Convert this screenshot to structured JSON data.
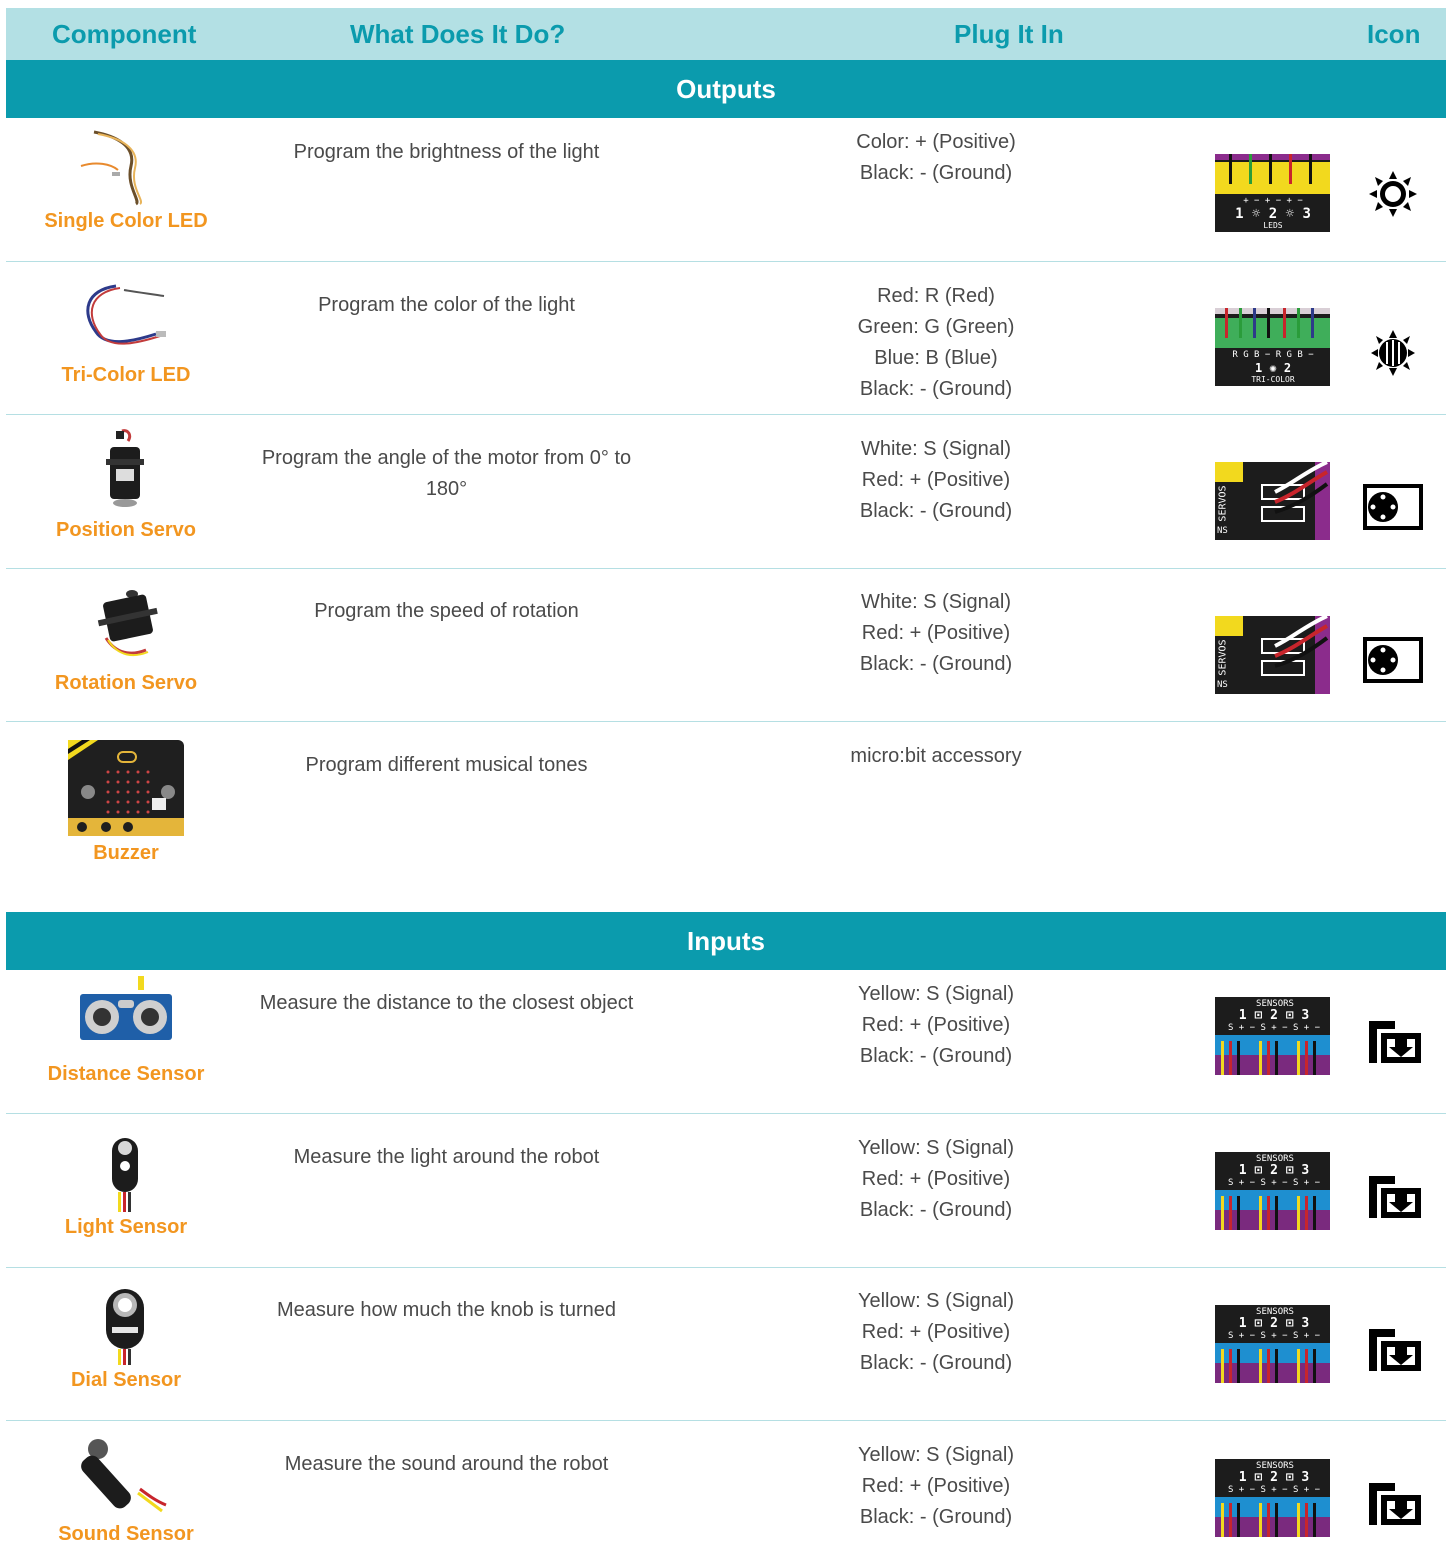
{
  "header": {
    "component": "Component",
    "what": "What Does It Do?",
    "plug": "Plug It In",
    "icon": "Icon"
  },
  "colors": {
    "header_bg": "#b3e0e4",
    "header_text": "#0b9bad",
    "section_bg": "#0b9bad",
    "component_name": "#f29620",
    "body_text": "#4a4a4a",
    "separator": "#b5dfe3"
  },
  "sections": [
    {
      "title": "Outputs",
      "rows": [
        {
          "name": "Single Color LED",
          "image": "single-color-led-image",
          "description": "Program the brightness of the light",
          "plug": [
            "Color: + (Positive)",
            "Black: - (Ground)"
          ],
          "board": "leds-port-image",
          "icon": "led-sun-icon"
        },
        {
          "name": "Tri-Color LED",
          "image": "tri-color-led-image",
          "description": "Program the color of the light",
          "plug": [
            "Red: R (Red)",
            "Green: G (Green)",
            "Blue: B (Blue)",
            "Black: - (Ground)"
          ],
          "board": "tri-color-port-image",
          "icon": "tri-color-led-icon"
        },
        {
          "name": "Position Servo",
          "image": "position-servo-image",
          "description": "Program the angle of the motor from 0° to 180°",
          "plug": [
            "White: S (Signal)",
            "Red: + (Positive)",
            "Black: - (Ground)"
          ],
          "board": "servos-port-image",
          "icon": "servo-icon"
        },
        {
          "name": "Rotation Servo",
          "image": "rotation-servo-image",
          "description": "Program the speed of rotation",
          "plug": [
            "White: S (Signal)",
            "Red: + (Positive)",
            "Black: - (Ground)"
          ],
          "board": "servos-port-image",
          "icon": "servo-icon"
        },
        {
          "name": "Buzzer",
          "image": "microbit-image",
          "description": "Program different musical tones",
          "plug": [
            "micro:bit accessory"
          ],
          "board": "",
          "icon": ""
        }
      ]
    },
    {
      "title": "Inputs",
      "rows": [
        {
          "name": "Distance Sensor",
          "image": "distance-sensor-image",
          "description": "Measure the distance to the closest object",
          "plug": [
            "Yellow: S (Signal)",
            "Red: + (Positive)",
            "Black: - (Ground)"
          ],
          "board": "sensors-port-image",
          "icon": "sensor-input-icon"
        },
        {
          "name": "Light Sensor",
          "image": "light-sensor-image",
          "description": "Measure the light around the robot",
          "plug": [
            "Yellow: S (Signal)",
            "Red: + (Positive)",
            "Black: - (Ground)"
          ],
          "board": "sensors-port-image",
          "icon": "sensor-input-icon"
        },
        {
          "name": "Dial Sensor",
          "image": "dial-sensor-image",
          "description": "Measure how much the knob is turned",
          "plug": [
            "Yellow: S (Signal)",
            "Red: + (Positive)",
            "Black: - (Ground)"
          ],
          "board": "sensors-port-image",
          "icon": "sensor-input-icon"
        },
        {
          "name": "Sound Sensor",
          "image": "sound-sensor-image",
          "description": "Measure the sound around the robot",
          "plug": [
            "Yellow: S (Signal)",
            "Red: + (Positive)",
            "Black: - (Ground)"
          ],
          "board": "sensors-port-image",
          "icon": "sensor-input-icon"
        }
      ]
    }
  ],
  "board_labels": {
    "leds": [
      "+ − + − + −",
      "1 ☼ 2 ☼ 3",
      "LEDS"
    ],
    "tricolor": [
      "R G B −   R G B −",
      "1  ✺  2",
      "TRI-COLOR"
    ],
    "servos": "SERVOS",
    "servos_ns": "NS",
    "sensors": [
      "SENSORS",
      "1 ⊡ 2 ⊡ 3",
      "S + −  S + −  S + −"
    ]
  }
}
